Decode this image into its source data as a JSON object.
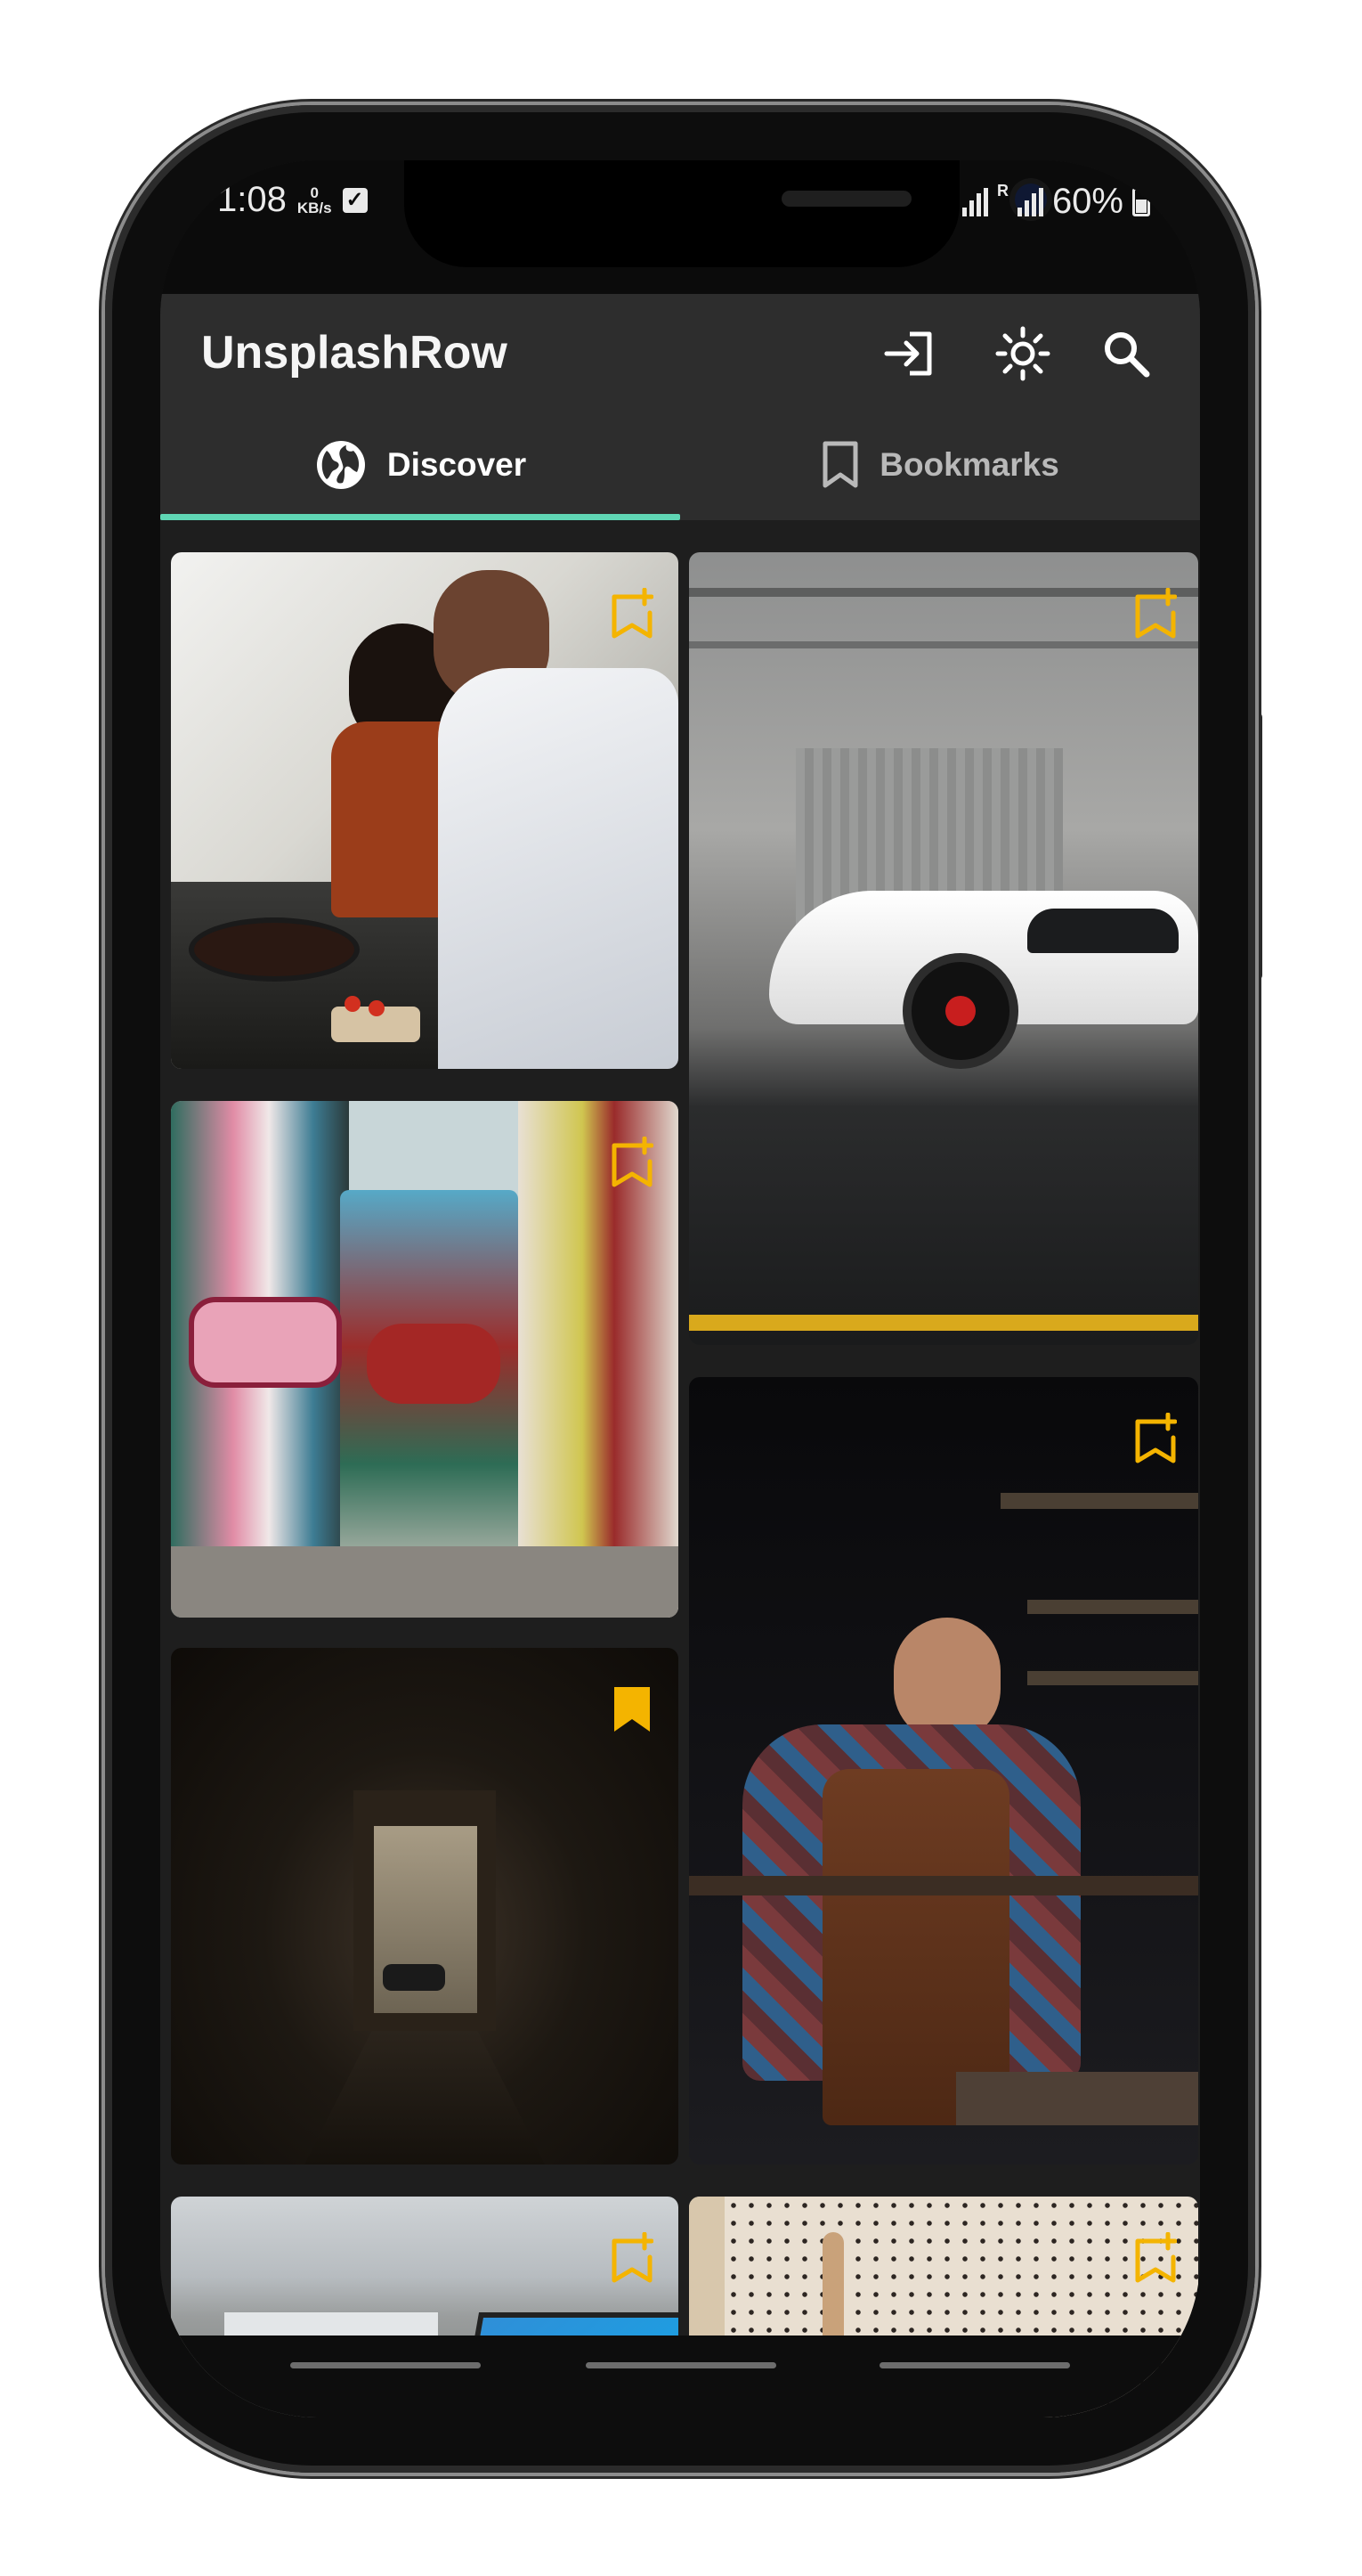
{
  "status_bar": {
    "time": "1:08",
    "net_speed_value": "0",
    "net_speed_unit": "KB/s",
    "signal_label": "R",
    "battery": "60%"
  },
  "app": {
    "title": "UnsplashRow",
    "actions": [
      "login-icon",
      "theme-icon",
      "search-icon"
    ]
  },
  "tabs": [
    {
      "label": "Discover",
      "icon": "globe-icon",
      "selected": true
    },
    {
      "label": "Bookmarks",
      "icon": "bookmark-outline-icon",
      "selected": false
    }
  ],
  "colors": {
    "accent": "#5fd6b4",
    "bookmark": "#f4b400",
    "app_bar": "#2d2d2d",
    "background": "#1e1e1e"
  },
  "photos": [
    {
      "subject": "couple cooking in kitchen",
      "bookmarked": false
    },
    {
      "subject": "white sports car by garage wall",
      "bookmarked": false
    },
    {
      "subject": "graffiti covered pillars",
      "bookmarked": false
    },
    {
      "subject": "dark corridor opening to a street",
      "bookmarked": true
    },
    {
      "subject": "man in leather apron in workshop",
      "bookmarked": false
    },
    {
      "subject": "blue laptop near window",
      "bookmarked": false
    },
    {
      "subject": "pegboard wall",
      "bookmarked": false
    }
  ]
}
